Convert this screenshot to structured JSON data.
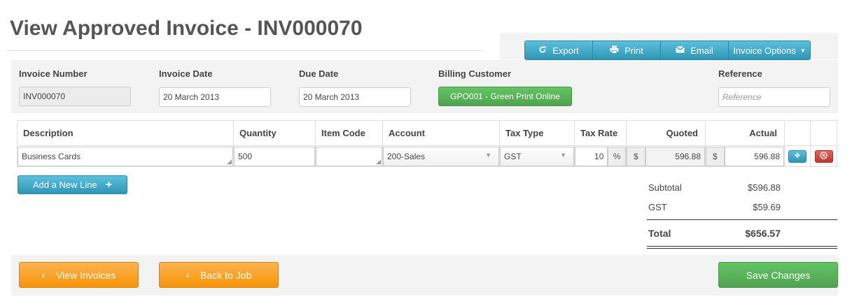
{
  "page": {
    "title": "View Approved Invoice - INV000070"
  },
  "toolbar": {
    "export_label": "Export",
    "print_label": "Print",
    "email_label": "Email",
    "options_label": "Invoice Options",
    "export_icon": "export-icon",
    "print_icon": "print-icon",
    "email_icon": "email-icon"
  },
  "header": {
    "invoice_number_label": "Invoice Number",
    "invoice_number_value": "INV000070",
    "invoice_date_label": "Invoice Date",
    "invoice_date_value": "20 March 2013",
    "due_date_label": "Due Date",
    "due_date_value": "20 March 2013",
    "billing_customer_label": "Billing Customer",
    "billing_customer_value": "GPO001 - Green Print Online",
    "reference_label": "Reference",
    "reference_placeholder": "Reference"
  },
  "lines": {
    "columns": {
      "description": "Description",
      "quantity": "Quantity",
      "item_code": "Item Code",
      "account": "Account",
      "tax_type": "Tax Type",
      "tax_rate": "Tax Rate",
      "quoted": "Quoted",
      "actual": "Actual"
    },
    "rows": [
      {
        "description": "Business Cards",
        "quantity": "500",
        "item_code": "",
        "account": "200-Sales",
        "tax_type": "GST",
        "tax_rate": "10",
        "percent_symbol": "%",
        "currency_symbol": "$",
        "quoted": "596.88",
        "actual": "596.88"
      }
    ],
    "add_label": "Add a New Line"
  },
  "totals": {
    "subtotal_label": "Subtotal",
    "subtotal_value": "$596.88",
    "gst_label": "GST",
    "gst_value": "$59.69",
    "total_label": "Total",
    "total_value": "$656.57"
  },
  "footer": {
    "view_invoices_label": "View Invoices",
    "back_to_job_label": "Back to Job",
    "save_label": "Save Changes"
  },
  "colors": {
    "blue": "#2f96b4",
    "green": "#51a351",
    "orange": "#f89406",
    "red": "#bd362f"
  }
}
